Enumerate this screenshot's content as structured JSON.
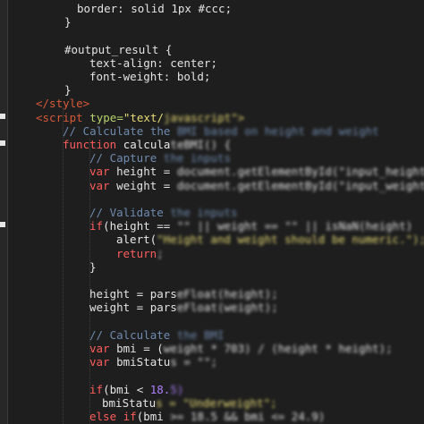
{
  "editor": {
    "lines": [
      {
        "tokens": [
          {
            "t": "border: solid 1px #ccc;",
            "c": "s-prop"
          }
        ]
      },
      {
        "tokens": [
          {
            "t": "}",
            "c": "s-plain"
          }
        ]
      },
      {
        "tokens": []
      },
      {
        "tokens": [
          {
            "t": "#output_result {",
            "c": "s-plain"
          }
        ]
      },
      {
        "tokens": [
          {
            "t": "text-align: center;",
            "c": "s-prop"
          }
        ]
      },
      {
        "tokens": [
          {
            "t": "font-weight: bold;",
            "c": "s-prop"
          }
        ]
      },
      {
        "tokens": [
          {
            "t": "}",
            "c": "s-plain"
          }
        ]
      },
      {
        "tokens": [
          {
            "t": "</style>",
            "c": "s-tag"
          }
        ]
      },
      {
        "tokens": [
          {
            "t": "<script ",
            "c": "s-tag"
          },
          {
            "t": "type=",
            "c": "s-attr"
          },
          {
            "t": "\"text/",
            "c": "s-str"
          },
          {
            "t": "javascript\">",
            "c": "s-str",
            "blur": true
          }
        ]
      },
      {
        "tokens": [
          {
            "t": "// Calculate the ",
            "c": "s-cmt"
          },
          {
            "t": "BMI based on height and weight",
            "c": "s-cmt",
            "blur": true
          }
        ]
      },
      {
        "tokens": [
          {
            "t": "function ",
            "c": "s-kw"
          },
          {
            "t": "calcula",
            "c": "s-fn"
          },
          {
            "t": "teBMI() {",
            "c": "s-fn",
            "blur": true
          }
        ]
      },
      {
        "tokens": [
          {
            "t": "// Capture ",
            "c": "s-cmt"
          },
          {
            "t": "the inputs",
            "c": "s-cmt",
            "blur": true
          }
        ]
      },
      {
        "tokens": [
          {
            "t": "var ",
            "c": "s-kw"
          },
          {
            "t": "height = ",
            "c": "s-plain"
          },
          {
            "t": "document.getElementById(\"input_height\")",
            "c": "s-plain",
            "blur": true
          }
        ]
      },
      {
        "tokens": [
          {
            "t": "var ",
            "c": "s-kw"
          },
          {
            "t": "weight = ",
            "c": "s-plain"
          },
          {
            "t": "document.getElementById(\"input_weight\")",
            "c": "s-plain",
            "blur": true
          }
        ]
      },
      {
        "tokens": []
      },
      {
        "tokens": [
          {
            "t": "// Validate ",
            "c": "s-cmt"
          },
          {
            "t": "the inputs",
            "c": "s-cmt",
            "blur": true
          }
        ]
      },
      {
        "tokens": [
          {
            "t": "if",
            "c": "s-kw"
          },
          {
            "t": "(height == ",
            "c": "s-plain"
          },
          {
            "t": "\"\" || weight == \"\" || isNaN(height)",
            "c": "s-plain",
            "blur": true
          }
        ]
      },
      {
        "tokens": [
          {
            "t": "alert(",
            "c": "s-fn"
          },
          {
            "t": "\"Height and weight should be numeric.\");",
            "c": "s-str",
            "blur": true
          }
        ]
      },
      {
        "tokens": [
          {
            "t": "return",
            "c": "s-kw"
          },
          {
            "t": ";",
            "c": "s-plain",
            "blur": true
          }
        ]
      },
      {
        "tokens": [
          {
            "t": "}",
            "c": "s-plain"
          }
        ]
      },
      {
        "tokens": []
      },
      {
        "tokens": [
          {
            "t": "height = pars",
            "c": "s-plain"
          },
          {
            "t": "eFloat(height);",
            "c": "s-plain",
            "blur": true
          }
        ]
      },
      {
        "tokens": [
          {
            "t": "weight = pars",
            "c": "s-plain"
          },
          {
            "t": "eFloat(weight);",
            "c": "s-plain",
            "blur": true
          }
        ]
      },
      {
        "tokens": []
      },
      {
        "tokens": [
          {
            "t": "// Calculate ",
            "c": "s-cmt"
          },
          {
            "t": "the BMI",
            "c": "s-cmt",
            "blur": true
          }
        ]
      },
      {
        "tokens": [
          {
            "t": "var ",
            "c": "s-kw"
          },
          {
            "t": "bmi = (",
            "c": "s-plain"
          },
          {
            "t": "weight * 703) / (height * height);",
            "c": "s-plain",
            "blur": true
          }
        ]
      },
      {
        "tokens": [
          {
            "t": "var ",
            "c": "s-kw"
          },
          {
            "t": "bmiStatu",
            "c": "s-plain"
          },
          {
            "t": "s = \"\";",
            "c": "s-plain",
            "blur": true
          }
        ]
      },
      {
        "tokens": []
      },
      {
        "tokens": [
          {
            "t": "if",
            "c": "s-kw"
          },
          {
            "t": "(bmi < ",
            "c": "s-plain"
          },
          {
            "t": "18.",
            "c": "s-num"
          },
          {
            "t": "5)",
            "c": "s-num",
            "blur": true
          }
        ]
      },
      {
        "tokens": [
          {
            "t": "bmiStatu",
            "c": "s-plain"
          },
          {
            "t": "s = \"Underweight\";",
            "c": "s-str",
            "blur": true
          }
        ]
      },
      {
        "tokens": [
          {
            "t": "else ",
            "c": "s-kw"
          },
          {
            "t": "if",
            "c": "s-kw"
          },
          {
            "t": "(bmi ",
            "c": "s-plain"
          },
          {
            "t": ">= 18.5 && bmi <= 24.9)",
            "c": "s-plain",
            "blur": true
          }
        ]
      }
    ]
  }
}
